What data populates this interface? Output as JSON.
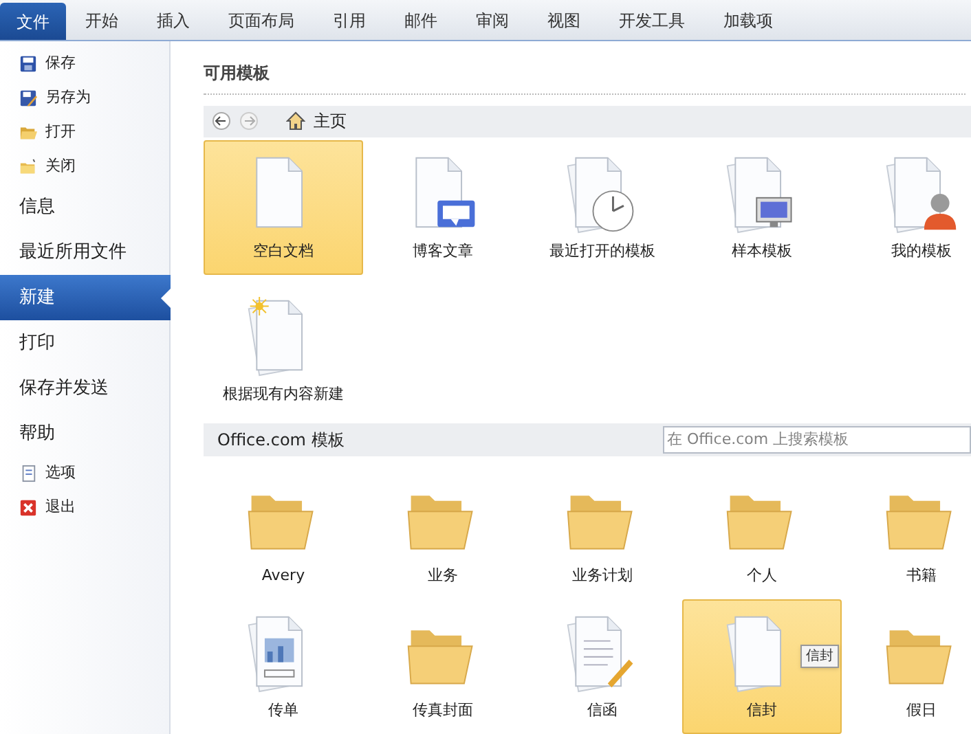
{
  "tabs": [
    {
      "label": "文件",
      "selected": true
    },
    {
      "label": "开始",
      "selected": false
    },
    {
      "label": "插入",
      "selected": false
    },
    {
      "label": "页面布局",
      "selected": false
    },
    {
      "label": "引用",
      "selected": false
    },
    {
      "label": "邮件",
      "selected": false
    },
    {
      "label": "审阅",
      "selected": false
    },
    {
      "label": "视图",
      "selected": false
    },
    {
      "label": "开发工具",
      "selected": false
    },
    {
      "label": "加载项",
      "selected": false
    }
  ],
  "sidebar": {
    "items": [
      {
        "kind": "command",
        "label": "保存"
      },
      {
        "kind": "command",
        "label": "另存为"
      },
      {
        "kind": "command",
        "label": "打开"
      },
      {
        "kind": "command",
        "label": "关闭"
      },
      {
        "kind": "page",
        "label": "信息",
        "selected": false
      },
      {
        "kind": "page",
        "label": "最近所用文件",
        "selected": false
      },
      {
        "kind": "page",
        "label": "新建",
        "selected": true
      },
      {
        "kind": "page",
        "label": "打印",
        "selected": false
      },
      {
        "kind": "page",
        "label": "保存并发送",
        "selected": false
      },
      {
        "kind": "page",
        "label": "帮助",
        "selected": false
      },
      {
        "kind": "command",
        "label": "选项"
      },
      {
        "kind": "command",
        "label": "退出"
      }
    ]
  },
  "available": {
    "heading": "可用模板",
    "breadcrumb": "主页",
    "items": [
      {
        "kind": "blank",
        "label": "空白文档",
        "selected": true
      },
      {
        "kind": "blog",
        "label": "博客文章",
        "selected": false
      },
      {
        "kind": "recent",
        "label": "最近打开的模板",
        "selected": false
      },
      {
        "kind": "sample",
        "label": "样本模板",
        "selected": false
      },
      {
        "kind": "mine",
        "label": "我的模板",
        "selected": false
      },
      {
        "kind": "existing",
        "label": "根据现有内容新建",
        "selected": false
      }
    ]
  },
  "office": {
    "heading": "Office.com 模板",
    "search": {
      "placeholder": "在 Office.com 上搜索模板"
    },
    "items": [
      {
        "kind": "folder",
        "label": "Avery",
        "selected": false
      },
      {
        "kind": "folder",
        "label": "业务",
        "selected": false
      },
      {
        "kind": "folder",
        "label": "业务计划",
        "selected": false
      },
      {
        "kind": "folder",
        "label": "个人",
        "selected": false
      },
      {
        "kind": "folder",
        "label": "书籍",
        "selected": false
      },
      {
        "kind": "flyer",
        "label": "传单",
        "selected": false
      },
      {
        "kind": "folder",
        "label": "传真封面",
        "selected": false
      },
      {
        "kind": "letter",
        "label": "信函",
        "selected": false
      },
      {
        "kind": "stack",
        "label": "信封",
        "selected": true,
        "tooltip": "信封"
      },
      {
        "kind": "folder",
        "label": "假日",
        "selected": false
      }
    ]
  }
}
